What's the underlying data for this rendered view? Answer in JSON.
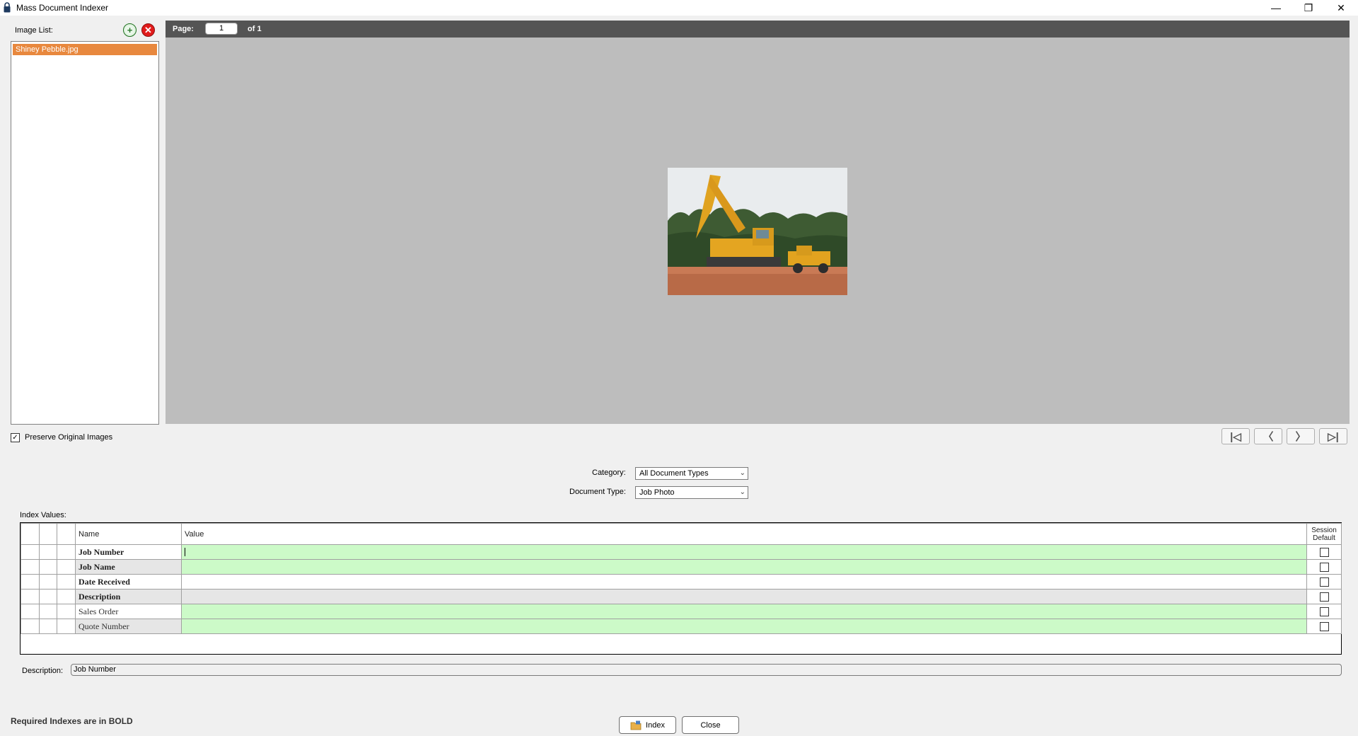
{
  "window": {
    "title": "Mass Document Indexer",
    "controls": [
      "—",
      "❐",
      "✕"
    ]
  },
  "image_list": {
    "label": "Image List:",
    "items": [
      "Shiney Pebble.jpg"
    ],
    "selected_index": 0
  },
  "viewer": {
    "page_label": "Page:",
    "page_value": "1",
    "page_of": "of 1"
  },
  "preserve": {
    "label": "Preserve Original Images",
    "checked": true
  },
  "nav": {
    "first": "|◁",
    "prev": "〈",
    "next": "〉",
    "last": "▷|"
  },
  "category": {
    "label": "Category:",
    "value": "All Document Types"
  },
  "document_type": {
    "label": "Document Type:",
    "value": "Job Photo"
  },
  "index_values": {
    "label": "Index Values:",
    "headers": {
      "name": "Name",
      "value": "Value",
      "session_default_1": "Session",
      "session_default_2": "Default"
    },
    "rows": [
      {
        "name": "Job Number",
        "value": "",
        "required": true
      },
      {
        "name": "Job Name",
        "value": "",
        "required": true
      },
      {
        "name": "Date Received",
        "value": "",
        "required": true
      },
      {
        "name": "Description",
        "value": "",
        "required": true
      },
      {
        "name": "Sales Order",
        "value": "",
        "required": false
      },
      {
        "name": "Quote Number",
        "value": "",
        "required": false
      }
    ]
  },
  "description": {
    "label": "Description:",
    "value": "Job Number"
  },
  "footer": {
    "required_note": "Required Indexes are in BOLD",
    "index_button": "Index",
    "close_button": "Close"
  },
  "colors": {
    "selection": "#e8883e",
    "required_value_bg": "#ccfac8",
    "viewer_bg": "#bdbdbd",
    "toolbar_bg": "#545454"
  }
}
